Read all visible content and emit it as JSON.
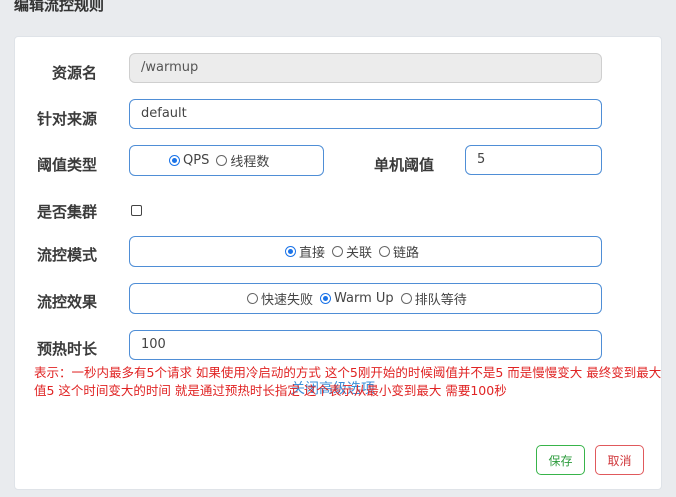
{
  "dialog_title": "编辑流控规则",
  "resource_name": {
    "label": "资源名",
    "value": "/warmup"
  },
  "limit_app": {
    "label": "针对来源",
    "value": "default"
  },
  "threshold_type": {
    "label": "阈值类型",
    "options": [
      "QPS",
      "线程数"
    ],
    "selected": "QPS"
  },
  "single_threshold": {
    "label": "单机阈值",
    "value": "5"
  },
  "cluster": {
    "label": "是否集群",
    "checked": false
  },
  "flow_mode": {
    "label": "流控模式",
    "options": [
      "直接",
      "关联",
      "链路"
    ],
    "selected": "直接"
  },
  "flow_effect": {
    "label": "流控效果",
    "options": [
      "快速失败",
      "Warm Up",
      "排队等待"
    ],
    "selected": "Warm Up"
  },
  "warmup_period": {
    "label": "预热时长",
    "value": "100"
  },
  "advanced_toggle": "关闭高级选项",
  "note": "表示：一秒内最多有5个请求   如果使用冷启动的方式 这个5刚开始的时候阈值并不是5 而是慢慢变大 最终变到最大值5  这个时间变大的时间 就是通过预热时长指定    这个表示从最小变到最大 需要100秒",
  "buttons": {
    "save": "保存",
    "cancel": "取消"
  },
  "colors": {
    "accent": "#4f8ed6",
    "radio": "#1a73e8",
    "note": "#e02424",
    "save": "#38b44a",
    "cancel": "#e0595c"
  }
}
